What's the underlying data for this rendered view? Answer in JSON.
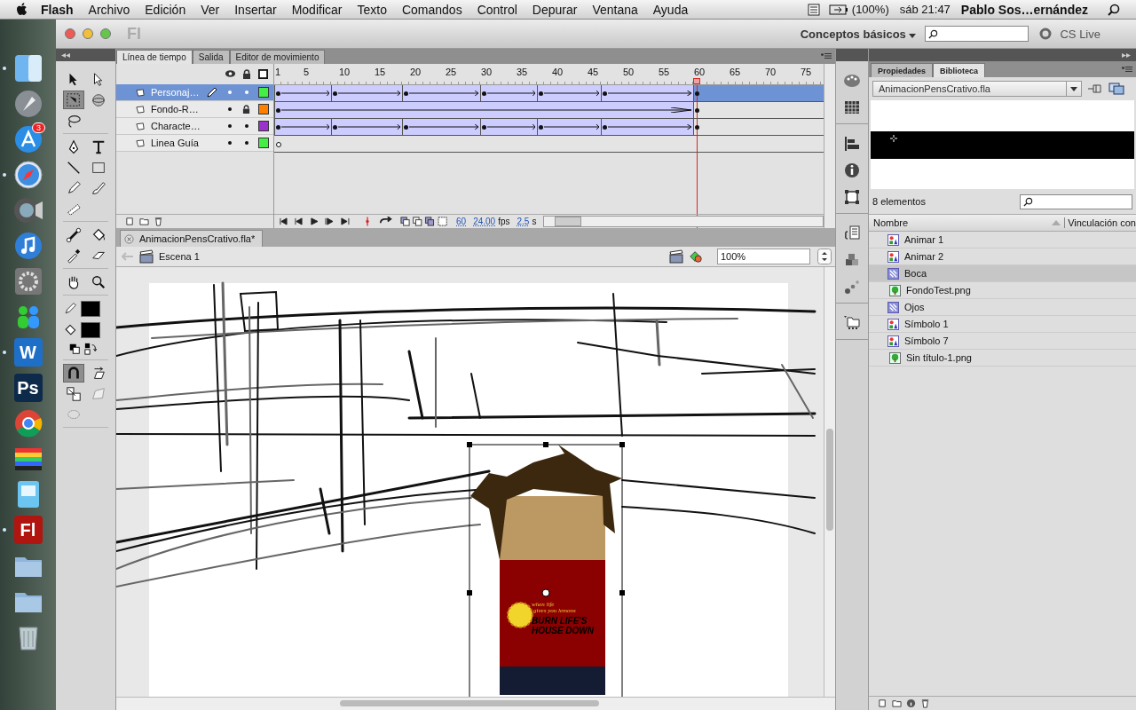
{
  "menu_bar": {
    "app": "Flash",
    "menus": [
      "Archivo",
      "Edición",
      "Ver",
      "Insertar",
      "Modificar",
      "Texto",
      "Comandos",
      "Control",
      "Depurar",
      "Ventana",
      "Ayuda"
    ],
    "battery": "(100%)",
    "clock": "sáb 21:47",
    "user": "Pablo Sos…ernández"
  },
  "dock": [
    {
      "kind": "finder",
      "running": true
    },
    {
      "kind": "rocket",
      "running": false
    },
    {
      "kind": "store",
      "running": false,
      "badge": "3"
    },
    {
      "kind": "compass",
      "running": true
    },
    {
      "kind": "camera",
      "running": false
    },
    {
      "kind": "music",
      "running": false
    },
    {
      "kind": "gear",
      "running": false
    },
    {
      "kind": "people",
      "running": false
    },
    {
      "kind": "letter",
      "running": true,
      "label": "W",
      "color": "#1e6fc8"
    },
    {
      "kind": "letter",
      "running": false,
      "label": "Ps",
      "color": "#0d2a4a"
    },
    {
      "kind": "chrome",
      "running": false
    },
    {
      "kind": "stripes",
      "running": false
    },
    {
      "kind": "preview",
      "running": false
    },
    {
      "kind": "letter",
      "running": true,
      "label": "Fl",
      "color": "#b0150f"
    },
    {
      "kind": "folder",
      "running": false
    },
    {
      "kind": "folder",
      "running": false
    },
    {
      "kind": "trash",
      "running": false
    }
  ],
  "window": {
    "app_mark": "Fl",
    "workspace": "Conceptos básicos",
    "cs_live": "CS Live"
  },
  "timeline": {
    "tabs": [
      {
        "label": "Línea de tiempo",
        "selected": true
      },
      {
        "label": "Salida",
        "selected": false
      },
      {
        "label": "Editor de movimiento",
        "selected": false
      }
    ],
    "ruler": [
      "1",
      "5",
      "10",
      "15",
      "20",
      "25",
      "30",
      "35",
      "40",
      "45",
      "50",
      "55",
      "60",
      "65",
      "70",
      "75"
    ],
    "layers": [
      {
        "name": "Personaj…",
        "selected": true,
        "locked": false,
        "color": "#44ee44",
        "kind": "tween",
        "keyframes": [
          true,
          false,
          false,
          false,
          false,
          false,
          false,
          false,
          true,
          false,
          false,
          false,
          false,
          false,
          false,
          false,
          false,
          false,
          true,
          false,
          false,
          false,
          false,
          false,
          false,
          false,
          false,
          false,
          false,
          true,
          false,
          false,
          false,
          false,
          false,
          false,
          false,
          true,
          false,
          false,
          false,
          false,
          false,
          false,
          false,
          false,
          true,
          false,
          false,
          false,
          false,
          false,
          false,
          false,
          false,
          false,
          false,
          false,
          false,
          true
        ]
      },
      {
        "name": "Fondo-R…",
        "selected": false,
        "locked": true,
        "color": "#ff7f00",
        "kind": "tween",
        "keyframes": [
          true,
          false,
          false,
          false,
          false,
          false,
          false,
          false,
          false,
          false,
          false,
          false,
          false,
          false,
          false,
          false,
          false,
          false,
          false,
          false,
          false,
          false,
          false,
          false,
          false,
          false,
          false,
          false,
          false,
          false,
          false,
          false,
          false,
          false,
          false,
          false,
          false,
          false,
          false,
          false,
          false,
          false,
          false,
          false,
          false,
          false,
          false,
          false,
          false,
          false,
          false,
          false,
          false,
          false,
          false,
          false,
          false,
          false,
          false,
          true
        ]
      },
      {
        "name": "Characte…",
        "selected": false,
        "locked": false,
        "color": "#9933cc",
        "kind": "tween",
        "keyframes": [
          true,
          false,
          false,
          false,
          false,
          false,
          false,
          false,
          true,
          false,
          false,
          false,
          false,
          false,
          false,
          false,
          false,
          false,
          true,
          false,
          false,
          false,
          false,
          false,
          false,
          false,
          false,
          false,
          false,
          true,
          false,
          false,
          false,
          false,
          false,
          false,
          false,
          true,
          false,
          false,
          false,
          false,
          false,
          false,
          false,
          false,
          true,
          false,
          false,
          false,
          false,
          false,
          false,
          false,
          false,
          false,
          false,
          false,
          false,
          true
        ]
      },
      {
        "name": "Linea Guía",
        "selected": false,
        "locked": false,
        "color": "#44ee44",
        "kind": "empty",
        "keyframes": [
          true
        ]
      }
    ],
    "current_frame": "60",
    "frame_rate": "24.00",
    "fps_unit": "fps",
    "elapsed": "2.5",
    "elapsed_unit": "s"
  },
  "document": {
    "tab": "AnimacionPensCrativo.fla*",
    "scene": "Escena 1",
    "zoom": "100%"
  },
  "stage": {
    "shirt_caption": [
      "when life",
      "gives you lemons"
    ],
    "shirt_slogan": [
      "BURN LIFE'S",
      "HOUSE DOWN"
    ]
  },
  "tools": [
    {
      "kind": "arrow",
      "selected": false
    },
    {
      "kind": "subselect",
      "selected": false
    },
    {
      "kind": "transform",
      "selected": true
    },
    {
      "kind": "rotate3d",
      "selected": false
    },
    {
      "kind": "lasso",
      "selected": false
    },
    {
      "kind": "pen",
      "selected": false
    },
    {
      "kind": "text",
      "selected": false
    },
    {
      "kind": "line",
      "selected": false
    },
    {
      "kind": "rect",
      "selected": false
    },
    {
      "kind": "pencil",
      "selected": false
    },
    {
      "kind": "brush",
      "selected": false
    },
    {
      "kind": "deco",
      "selected": false
    },
    {
      "kind": "bone",
      "selected": false
    },
    {
      "kind": "bucket",
      "selected": false
    },
    {
      "kind": "dropper",
      "selected": false
    },
    {
      "kind": "eraser",
      "selected": false
    },
    {
      "kind": "hand",
      "selected": false
    },
    {
      "kind": "zoom",
      "selected": false
    }
  ],
  "swatches": [
    {
      "kind": "stroke",
      "color": "#000000"
    },
    {
      "kind": "fill",
      "color": "#000000"
    }
  ],
  "options": [
    {
      "kind": "magnet",
      "selected": true
    },
    {
      "kind": "skew",
      "selected": false
    },
    {
      "kind": "scale",
      "selected": false
    },
    {
      "kind": "distort",
      "selected": false
    },
    {
      "kind": "envelope",
      "selected": false
    }
  ],
  "library": {
    "tabs": [
      {
        "label": "Propiedades",
        "selected": false
      },
      {
        "label": "Biblioteca",
        "selected": true
      }
    ],
    "file": "AnimacionPensCrativo.fla",
    "count": "8 elementos",
    "columns": [
      "Nombre",
      "Vinculación con"
    ],
    "items": [
      {
        "name": "Animar 1",
        "kind": "graphic",
        "selected": false
      },
      {
        "name": "Animar 2",
        "kind": "graphic",
        "selected": false
      },
      {
        "name": "Boca",
        "kind": "clip",
        "selected": true
      },
      {
        "name": "FondoTest.png",
        "kind": "bitmap",
        "selected": false
      },
      {
        "name": "Ojos",
        "kind": "clip",
        "selected": false
      },
      {
        "name": "Símbolo 1",
        "kind": "graphic",
        "selected": false
      },
      {
        "name": "Símbolo 7",
        "kind": "graphic",
        "selected": false
      },
      {
        "name": "Sin título-1.png",
        "kind": "bitmap",
        "selected": false
      }
    ]
  }
}
